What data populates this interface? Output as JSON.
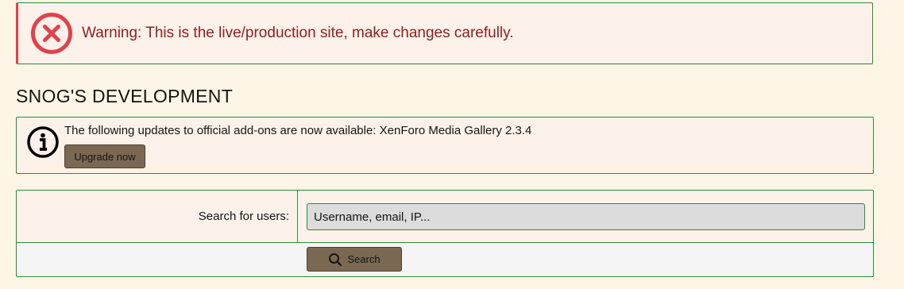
{
  "warning": {
    "icon": "error-circle-icon",
    "message": "Warning: This is the live/production site, make changes carefully."
  },
  "page": {
    "title": "SNOG'S DEVELOPMENT"
  },
  "notice": {
    "icon": "info-circle-icon",
    "text": "The following updates to official add-ons are now available: XenForo Media Gallery 2.3.4",
    "button_label": "Upgrade now"
  },
  "search": {
    "label": "Search for users:",
    "placeholder": "Username, email, IP...",
    "value": "",
    "button_label": "Search",
    "button_icon": "search-icon"
  },
  "colors": {
    "background": "#fdf5e6",
    "border": "#2e8b3a",
    "error": "#e0424b",
    "button": "#7a6853"
  }
}
